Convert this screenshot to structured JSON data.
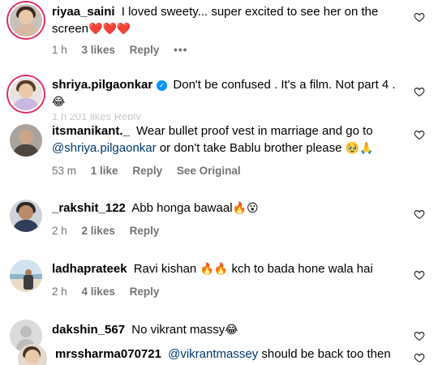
{
  "comments": [
    {
      "username": "riyaa_saini",
      "text": "I loved sweety... super excited to see her on the screen",
      "emoji": "❤️❤️❤️",
      "time": "1 h",
      "likes": "3 likes",
      "reply": "Reply",
      "more": "•••"
    },
    {
      "username": "shriya.pilgaonkar",
      "verified": true,
      "text": "Don't be confused . It's a film. Not part 4 .",
      "emoji": "😂",
      "partial_meta": "1 h   201 likes   Reply"
    },
    {
      "username": "itsmanikant._",
      "text_before": "Wear bullet proof vest in marriage and go to",
      "mention": "@shriya.pilgaonkar",
      "text_after": "or don't take Bablu brother please",
      "emoji": "🥹🙏",
      "time": "53 m",
      "likes": "1 like",
      "reply": "Reply",
      "see_original": "See Original"
    },
    {
      "username": "_rakshit_122",
      "text": "Abb honga bawaal",
      "emoji": "🔥😮",
      "time": "2 h",
      "likes": "2 likes",
      "reply": "Reply"
    },
    {
      "username": "ladhaprateek",
      "text": "Ravi kishan",
      "emoji": "🔥🔥",
      "text_after": "kch to bada hone wala hai",
      "time": "2 h",
      "likes": "4 likes",
      "reply": "Reply"
    },
    {
      "username": "dakshin_567",
      "text": "No vikrant massy",
      "emoji": "😂"
    },
    {
      "username": "mrssharma070721",
      "mention": "@vikrantmassey",
      "text": "should be back too then"
    }
  ]
}
